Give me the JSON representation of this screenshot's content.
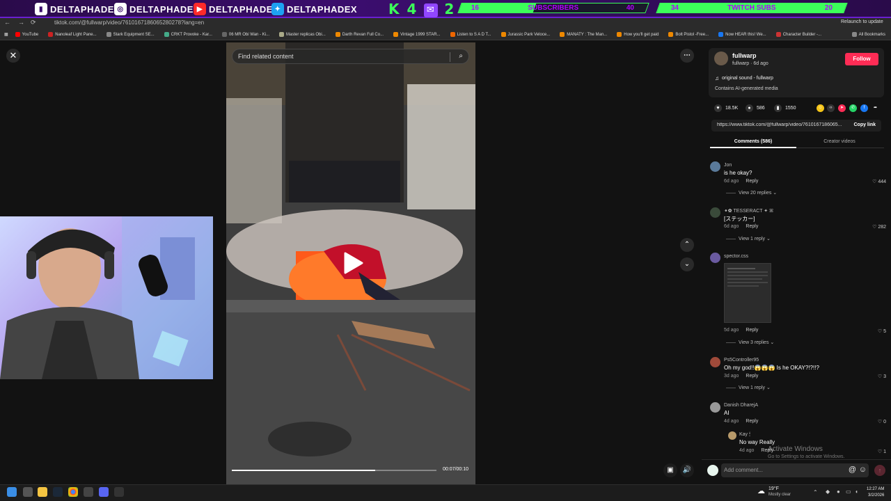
{
  "overlay": {
    "socials": [
      "DELTAPHADE",
      "DELTAPHADE",
      "DELTAPHADE",
      "DELTAPHADEX"
    ],
    "counter": "K 4",
    "counter_end": "2",
    "subs_goal": {
      "current": "16",
      "label": "SUBSCRIBERS",
      "target": "40",
      "progress": 0.4
    },
    "twitch_goal": {
      "current": "34",
      "label": "TWITCH SUBS",
      "target": "20",
      "progress": 1.0
    }
  },
  "browser": {
    "url": "tiktok.com/@fullwarp/video/7610167186065280278?lang=en",
    "update_label": "Relaunch to update",
    "bookmarks": [
      "YouTube",
      "Nanoleaf Light Pane...",
      "Stark Equipment SE...",
      "CRKT Provoke - Kar...",
      "06 MR Obi Wan - Ki...",
      "Master replicas Obi...",
      "Darth Revan Full Co...",
      "Vintage 1999 STAR...",
      "Listen to S A D T...",
      "Jurassic Park Veloce...",
      "MANATY : The Man...",
      "How you'll get paid",
      "Bolt Pistol -Free...",
      "Now HEAR this! We...",
      "Character Builder -..."
    ],
    "all_bookmarks": "All Bookmarks"
  },
  "video": {
    "search_placeholder": "Find related content",
    "time": "00:07/00:10",
    "progress": 0.7
  },
  "post": {
    "author": "fullwarp",
    "author_meta": "fullwarp · 6d ago",
    "follow_label": "Follow",
    "sound": "original sound - fullwarp",
    "ai_label": "Contains AI-generated media",
    "likes": "18.5K",
    "comments": "586",
    "saves": "1550",
    "link": "https://www.tiktok.com/@fullwarp/video/7610167186065...",
    "copy_label": "Copy link"
  },
  "tabs": {
    "comments": "Comments (586)",
    "creator": "Creator videos"
  },
  "comments": [
    {
      "name": "Jon",
      "text": "is he okay?",
      "date": "6d ago",
      "reply": "Reply",
      "likes": "444",
      "replies": "View 20 replies"
    },
    {
      "name": "ꔹ✿ TESSERACT ✦ ꕤ",
      "text": "[ステッカー]",
      "date": "6d ago",
      "reply": "Reply",
      "likes": "282",
      "replies": "View 1 reply"
    },
    {
      "name": "spector.css",
      "text": "",
      "date": "5d ago",
      "reply": "Reply",
      "likes": "5",
      "replies": "View 3 replies"
    },
    {
      "name": "Ps5Controller95",
      "text": "Oh my god!!😱😱😱 Is he OKAY?!?!!?",
      "date": "3d ago",
      "reply": "Reply",
      "likes": "3",
      "replies": "View 1 reply"
    },
    {
      "name": "Danish DharejA",
      "text": "AI",
      "date": "4d ago",
      "reply": "Reply",
      "likes": "0",
      "replies": ""
    },
    {
      "name": "Kay 🕯",
      "text": "No way Really",
      "date": "4d ago",
      "reply": "Reply",
      "likes": "1",
      "replies": ""
    }
  ],
  "comment_input": {
    "placeholder": "Add comment...",
    "post_icon": "arrow-up-icon"
  },
  "watermark": {
    "title": "Activate Windows",
    "subtitle": "Go to Settings to activate Windows."
  },
  "taskbar": {
    "weather_temp": "19°F",
    "weather_desc": "Mostly clear",
    "time": "12:27 AM",
    "date": "3/2/2026"
  }
}
